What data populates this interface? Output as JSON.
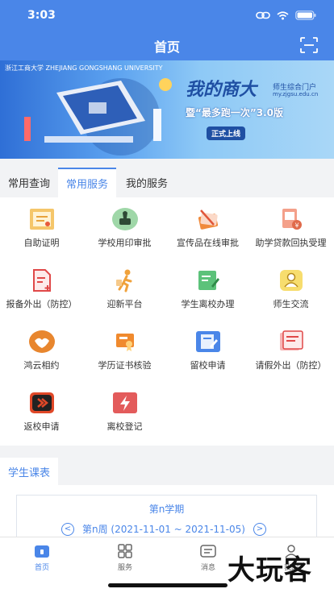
{
  "status_bar": {
    "time": "3:03"
  },
  "header": {
    "title": "首页"
  },
  "banner": {
    "logo_text": "浙江工商大学 ZHEJIANG GONGSHANG UNIVERSITY",
    "headline": "我的商大",
    "subtitle": "师生综合门户",
    "url": "my.zjgsu.edu.cn",
    "tagline": "暨“最多跑一次”3.0版",
    "badge": "正式上线"
  },
  "tabs": [
    "常用查询",
    "常用服务",
    "我的服务"
  ],
  "services": [
    {
      "label": "自助证明",
      "icon": "certificate-icon",
      "color": "#e8a33c"
    },
    {
      "label": "学校用印审批",
      "icon": "seal-stamp-icon",
      "color": "#3f9b5a"
    },
    {
      "label": "宣传品在线审批",
      "icon": "publicity-materials-icon",
      "color": "#e0563a"
    },
    {
      "label": "助学贷款回执受理",
      "icon": "loan-receipt-icon",
      "color": "#e06a4a"
    },
    {
      "label": "报备外出（防控）",
      "icon": "report-document-icon",
      "color": "#e04848"
    },
    {
      "label": "迎新平台",
      "icon": "walking-person-icon",
      "color": "#f0a23c"
    },
    {
      "label": "学生离校办理",
      "icon": "edit-form-icon",
      "color": "#3fae5a"
    },
    {
      "label": "师生交流",
      "icon": "user-chat-icon",
      "color": "#f2c94c"
    },
    {
      "label": "鸿云相约",
      "icon": "handshake-icon",
      "color": "#e8862e"
    },
    {
      "label": "学历证书核验",
      "icon": "diploma-icon",
      "color": "#f08a2e"
    },
    {
      "label": "留校申请",
      "icon": "stay-form-icon",
      "color": "#4a86e8"
    },
    {
      "label": "请假外出（防控）",
      "icon": "leave-slip-icon",
      "color": "#e04848"
    },
    {
      "label": "返校申请",
      "icon": "return-school-icon",
      "color": "#e04828"
    },
    {
      "label": "离校登记",
      "icon": "lightning-icon",
      "color": "#e35b5b"
    }
  ],
  "schedule": {
    "tab_label": "学生课表",
    "semester": "第n学期",
    "week": "第n周 (2021-11-01 ~ 2021-11-05)",
    "prev_label": "<",
    "next_label": ">"
  },
  "bottom_nav": [
    {
      "label": "首页",
      "icon": "home-icon"
    },
    {
      "label": "服务",
      "icon": "grid-icon"
    },
    {
      "label": "消息",
      "icon": "message-icon"
    },
    {
      "label": "我的",
      "icon": "profile-icon"
    }
  ],
  "watermark": "大玩客",
  "colors": {
    "primary": "#4a86e8",
    "background": "#f2f3f5"
  }
}
